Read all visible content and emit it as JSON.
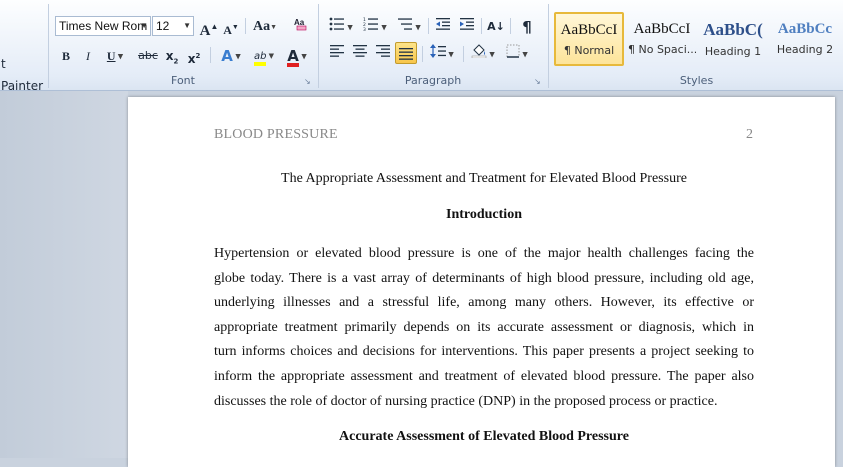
{
  "ribbon": {
    "clipboard": {
      "format_painter_label": "t Painter"
    },
    "font": {
      "group_label": "Font",
      "font_name": "Times New Rom",
      "font_size": "12",
      "grow_font": "A",
      "shrink_font": "A",
      "change_case": "Aa",
      "bold": "B",
      "italic": "I",
      "underline": "U",
      "strikethrough": "abc",
      "subscript": "x",
      "superscript": "x",
      "text_effects": "A",
      "highlight": "ab",
      "font_color": "A",
      "highlight_color": "#ffff00",
      "font_color_value": "#e02020"
    },
    "paragraph": {
      "group_label": "Paragraph",
      "show_hide": "¶",
      "sort": "A↓"
    },
    "styles": {
      "group_label": "Styles",
      "items": [
        {
          "sample": "AaBbCcI",
          "name": "¶ Normal",
          "selected": true
        },
        {
          "sample": "AaBbCcI",
          "name": "¶ No Spaci..."
        },
        {
          "sample": "AaBbC(",
          "name": "Heading 1"
        },
        {
          "sample": "AaBbCc",
          "name": "Heading 2"
        }
      ]
    }
  },
  "document": {
    "running_head": "BLOOD PRESSURE",
    "page_number": "2",
    "title": "The Appropriate Assessment  and Treatment  for Elevated Blood Pressure",
    "intro_heading": "Introduction",
    "intro_lines": [
      "Hypertension or elevated blood pressure is one of the major health challenges facing the",
      "globe today. There is a vast array of determinants of high blood pressure, including old age,",
      "underlying illnesses and a stressful life, among many others. However, its effective or",
      "appropriate treatment primarily depends on its accurate assessment or diagnosis, which in",
      "turn informs choices and decisions for interventions. This paper presents a project seeking to",
      "inform the appropriate assessment and treatment of elevated blood pressure. The paper also",
      "discusses  the role of doctor of nursing practice (DNP) in the proposed process or practice."
    ],
    "second_heading": "Accurate Assessment  of Elevated Blood Pressure"
  }
}
